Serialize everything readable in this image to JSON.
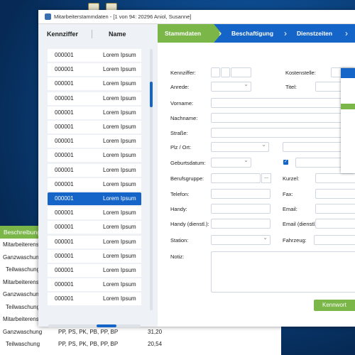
{
  "window": {
    "title": "Mitarbeiterstammdaten - [1 von 94: 20296 Aniol, Susanne]"
  },
  "list": {
    "col1": "Kennziffer",
    "col2": "Name",
    "rows": [
      {
        "id": "000001",
        "name": "Lorem Ipsum"
      },
      {
        "id": "000001",
        "name": "Lorem Ipsum"
      },
      {
        "id": "000001",
        "name": "Lorem Ipsum"
      },
      {
        "id": "000001",
        "name": "Lorem Ipsum"
      },
      {
        "id": "000001",
        "name": "Lorem Ipsum"
      },
      {
        "id": "000001",
        "name": "Lorem Ipsum"
      },
      {
        "id": "000001",
        "name": "Lorem Ipsum"
      },
      {
        "id": "000001",
        "name": "Lorem Ipsum"
      },
      {
        "id": "000001",
        "name": "Lorem Ipsum"
      },
      {
        "id": "000001",
        "name": "Lorem Ipsum"
      },
      {
        "id": "000001",
        "name": "Lorem Ipsum"
      },
      {
        "id": "000001",
        "name": "Lorem Ipsum"
      },
      {
        "id": "000001",
        "name": "Lorem Ipsum"
      },
      {
        "id": "000001",
        "name": "Lorem Ipsum"
      },
      {
        "id": "000001",
        "name": "Lorem Ipsum"
      },
      {
        "id": "000001",
        "name": "Lorem Ipsum"
      },
      {
        "id": "000001",
        "name": "Lorem Ipsum"
      },
      {
        "id": "000001",
        "name": "Lorem Ipsum"
      }
    ],
    "selected_index": 10
  },
  "tabs": [
    "Stammdaten",
    "Beschaftigung",
    "Dienstzeiten"
  ],
  "form": {
    "kennziffer": "Kennziffer:",
    "kostenstelle": "Kostenstelle:",
    "anrede": "Anrede:",
    "titel": "Titel:",
    "vorname": "Vorname:",
    "nachname": "Nachname:",
    "strasse": "Straße:",
    "plz_ort": "Plz / Ort:",
    "geburtsdatum": "Geburtsdatum:",
    "berufsgruppe": "Berufsgruppe:",
    "kurzel": "Kurzel:",
    "telefon": "Telefon:",
    "fax": "Fax:",
    "handy": "Handy:",
    "email": "Email:",
    "handy_dienstl": "Handy (dienstl.):",
    "email_dienstl": "Email (dienstl.):",
    "station": "Station:",
    "fahrzeug": "Fahrzeug:",
    "notiz": "Notiz:",
    "berufsgruppe_btn": "...",
    "kennwort_btn": "Kennwort"
  },
  "background_table": {
    "header": "Beschreibung",
    "rows": [
      {
        "c1": "Mitarbeiterens",
        "c2": "",
        "c3": ""
      },
      {
        "c1": "Ganzwaschung",
        "c2": "",
        "c3": ""
      },
      {
        "c1": "Teilwaschung",
        "c2": "",
        "c3": ""
      },
      {
        "c1": "Mitarbeiterens",
        "c2": "",
        "c3": ""
      },
      {
        "c1": "Ganzwaschung",
        "c2": "",
        "c3": ""
      },
      {
        "c1": "Teilwaschung",
        "c2": "",
        "c3": ""
      },
      {
        "c1": "Mitarbeiterens",
        "c2": "",
        "c3": ""
      },
      {
        "c1": "Ganzwaschung",
        "c2": "PP, PS, PK, PB, PP, BP",
        "c3": "31,20"
      },
      {
        "c1": "Teilwaschung",
        "c2": "PP, PS, PK, PB, PP, BP",
        "c3": "20,54"
      }
    ]
  },
  "colors": {
    "accent_blue": "#1565c9",
    "accent_green": "#7ab648"
  }
}
